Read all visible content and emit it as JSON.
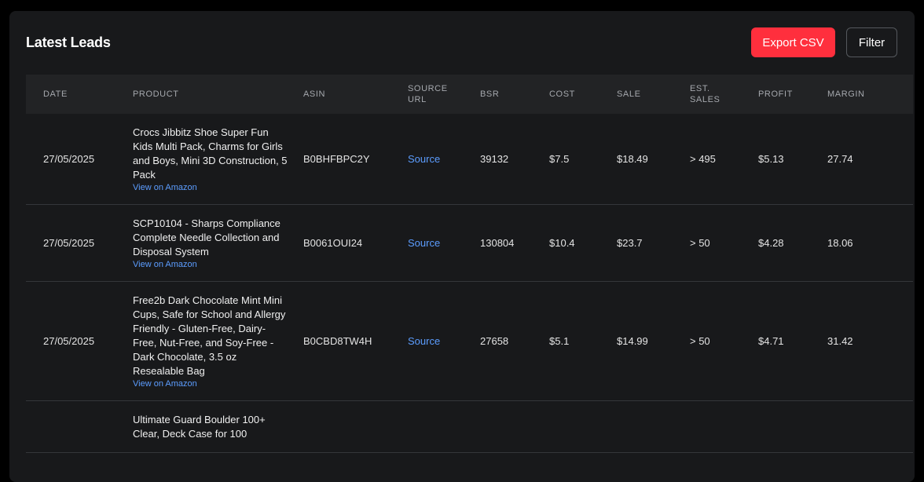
{
  "header": {
    "title": "Latest Leads",
    "export_label": "Export CSV",
    "filter_label": "Filter"
  },
  "table": {
    "columns": {
      "date": "DATE",
      "product": "PRODUCT",
      "asin": "ASIN",
      "source_url_line1": "SOURCE",
      "source_url_line2": "URL",
      "bsr": "BSR",
      "cost": "COST",
      "sale": "SALE",
      "est_sales_line1": "EST.",
      "est_sales_line2": "SALES",
      "profit": "PROFIT",
      "margin": "MARGIN"
    },
    "rows": [
      {
        "date": "27/05/2025",
        "product": "Crocs Jibbitz Shoe Super Fun Kids Multi Pack, Charms for Girls and Boys, Mini 3D Construction, 5 Pack",
        "amazon_link": "View on Amazon",
        "asin": "B0BHFBPC2Y",
        "source": "Source",
        "bsr": "39132",
        "cost": "$7.5",
        "sale": "$18.49",
        "est_sales": "> 495",
        "profit": "$5.13",
        "margin": "27.74"
      },
      {
        "date": "27/05/2025",
        "product": "SCP10104 - Sharps Compliance Complete Needle Collection and Disposal System",
        "amazon_link": "View on Amazon",
        "asin": "B0061OUI24",
        "source": "Source",
        "bsr": "130804",
        "cost": "$10.4",
        "sale": "$23.7",
        "est_sales": "> 50",
        "profit": "$4.28",
        "margin": "18.06"
      },
      {
        "date": "27/05/2025",
        "product": "Free2b Dark Chocolate Mint Mini Cups, Safe for School and Allergy Friendly - Gluten-Free, Dairy-Free, Nut-Free, and Soy-Free - Dark Chocolate, 3.5 oz Resealable Bag",
        "amazon_link": "View on Amazon",
        "asin": "B0CBD8TW4H",
        "source": "Source",
        "bsr": "27658",
        "cost": "$5.1",
        "sale": "$14.99",
        "est_sales": "> 50",
        "profit": "$4.71",
        "margin": "31.42"
      },
      {
        "date": "",
        "product": "Ultimate Guard Boulder 100+ Clear, Deck Case for 100",
        "amazon_link": "",
        "asin": "",
        "source": "",
        "bsr": "",
        "cost": "",
        "sale": "",
        "est_sales": "",
        "profit": "",
        "margin": ""
      }
    ]
  },
  "colors": {
    "page_bg": "#000000",
    "panel_bg": "#18191b",
    "header_row_bg": "#222325",
    "accent_red": "#ff2f3d",
    "link_blue": "#5c9dff"
  }
}
